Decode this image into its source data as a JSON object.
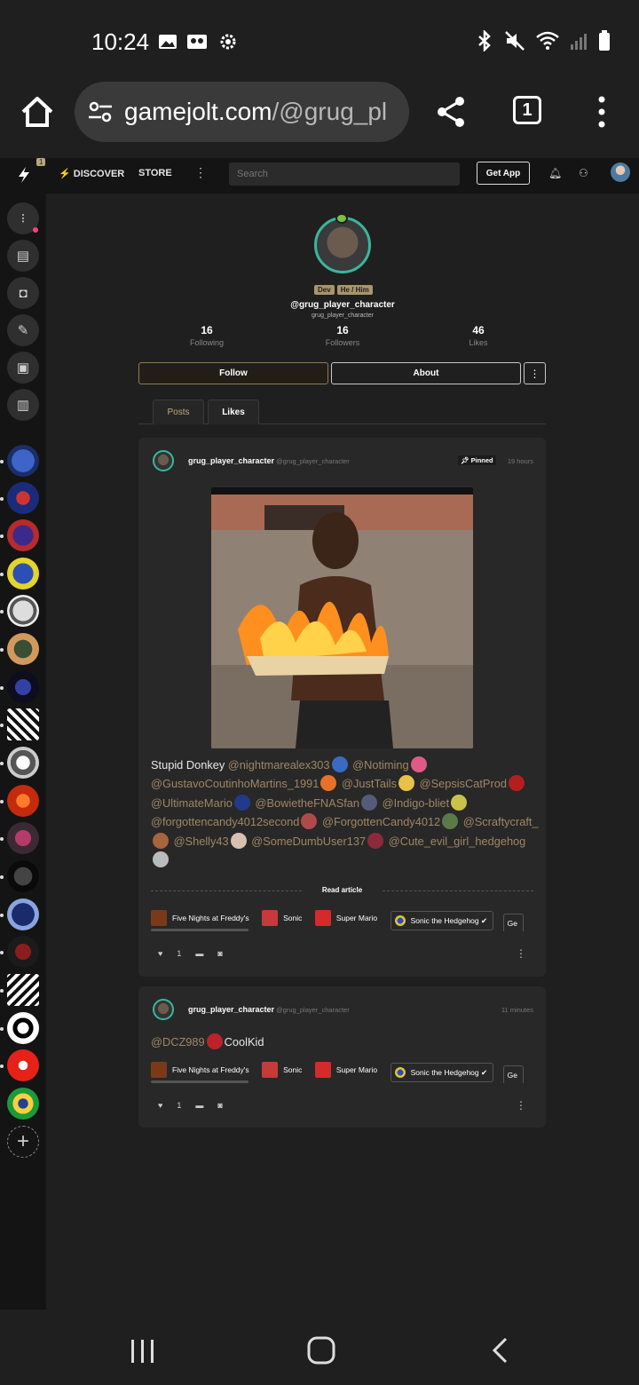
{
  "status_bar": {
    "time": "10:24"
  },
  "browser": {
    "url_host": "gamejolt.com",
    "url_path": "/@grug_pl",
    "tab_count": "1"
  },
  "gj_nav": {
    "notification_count": "1",
    "discover": "DISCOVER",
    "store": "STORE",
    "search_placeholder": "Search",
    "get_app": "Get App"
  },
  "profile": {
    "tags": [
      "Dev",
      "He / Him"
    ],
    "display_name": "@grug_player_character",
    "handle": "grug_player_character",
    "stats": [
      {
        "value": "16",
        "label": "Following"
      },
      {
        "value": "16",
        "label": "Followers"
      },
      {
        "value": "46",
        "label": "Likes"
      }
    ],
    "follow_label": "Follow",
    "about_label": "About",
    "tabs": [
      "Posts",
      "Likes"
    ]
  },
  "posts": [
    {
      "author": "grug_player_character",
      "author_handle": "@grug_player_character",
      "pinned_label": "Pinned",
      "time": "19 hours",
      "text_intro": "Stupid Donkey",
      "mentions": [
        "@nightmarealex303",
        "@Notiming",
        "@GustavoCoutinhoMartins_1991",
        "@JustTails",
        "@SepsisCatProd",
        "@UltimateMario",
        "@BowietheFNASfan",
        "@Indigo-bliet",
        "@forgottencandy4012second",
        "@ForgottenCandy4012",
        "@Scraftycraft_",
        "@Shelly43",
        "@SomeDumbUser137",
        "@Cute_evil_girl_hedgehog"
      ],
      "read_article": "Read article",
      "communities": [
        "Five Nights at Freddy's",
        "Sonic",
        "Super Mario",
        "Sonic the Hedgehog",
        "Ge"
      ],
      "likes": "1"
    },
    {
      "author": "grug_player_character",
      "author_handle": "@grug_player_character",
      "time": "11 minutes",
      "mention": "@DCZ989",
      "text_after": "CoolKid",
      "communities": [
        "Five Nights at Freddy's",
        "Sonic",
        "Super Mario",
        "Sonic the Hedgehog",
        "Ge"
      ],
      "likes": "1"
    }
  ],
  "colors": {
    "accent": "#c3a976",
    "teal_ring": "#3bb5a0",
    "background": "#1f1f1f",
    "card": "#282828"
  }
}
